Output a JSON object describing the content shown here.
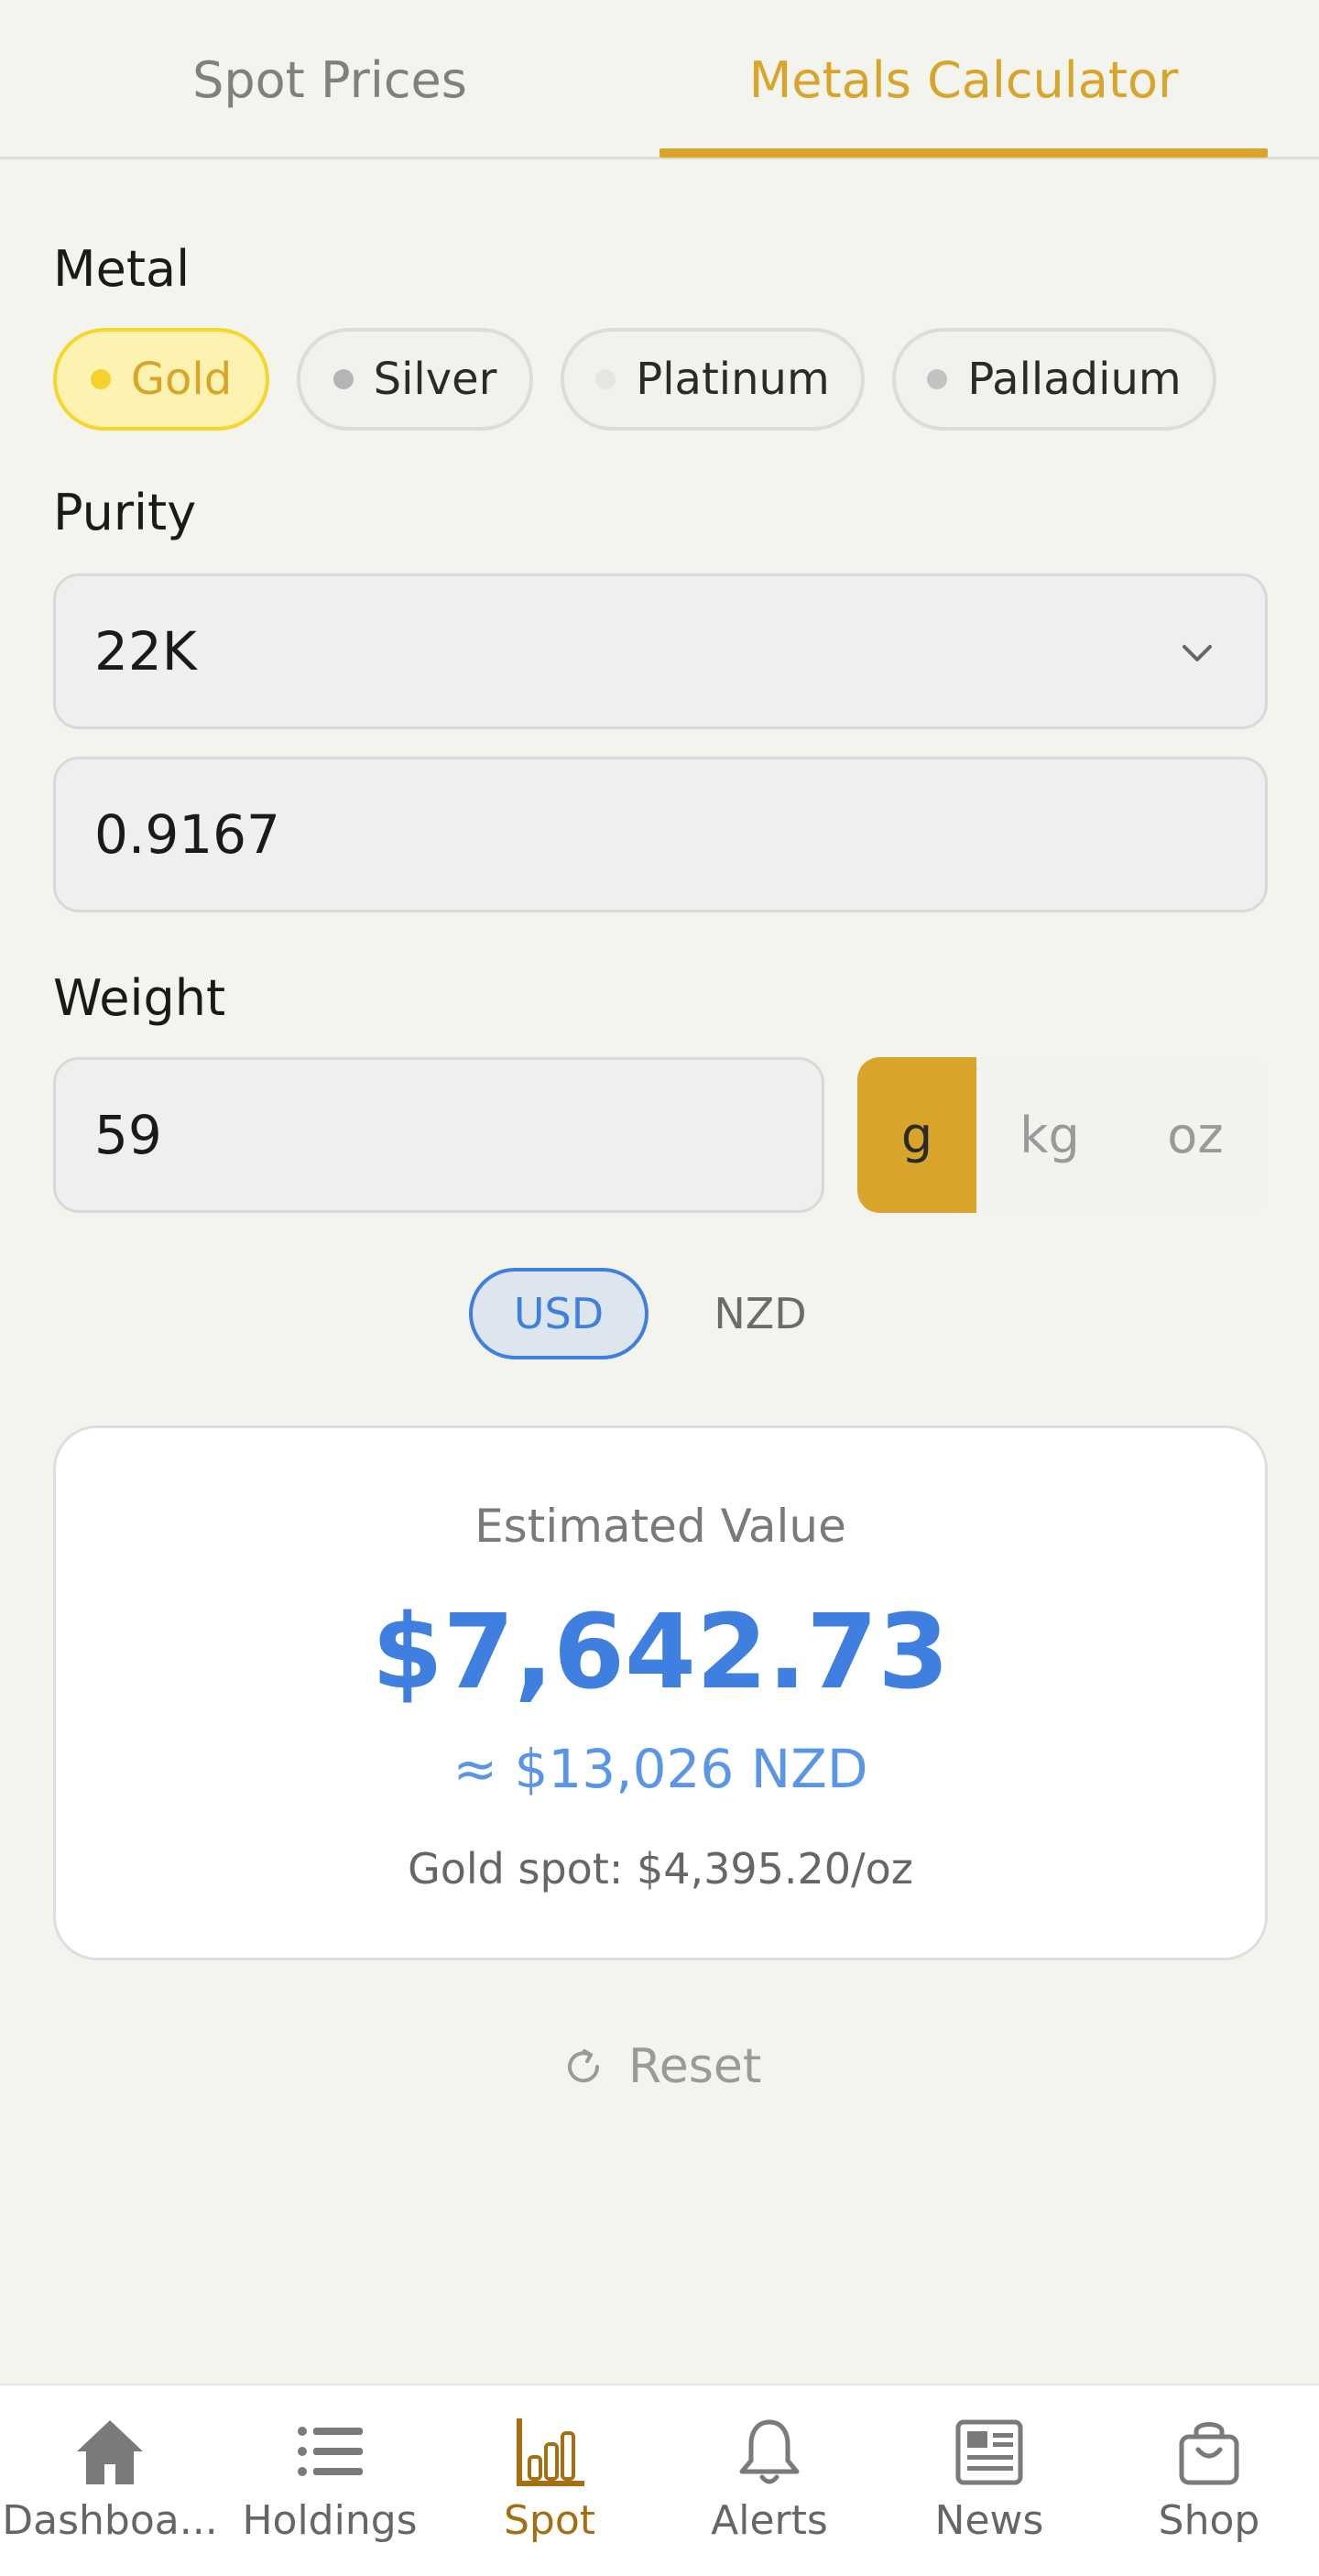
{
  "tabs": {
    "spot_prices": "Spot Prices",
    "metals_calculator": "Metals Calculator",
    "active": "metals_calculator"
  },
  "metal": {
    "label": "Metal",
    "options": [
      "Gold",
      "Silver",
      "Platinum",
      "Palladium"
    ],
    "selected": "Gold"
  },
  "purity": {
    "label": "Purity",
    "selected": "22K",
    "value": "0.9167"
  },
  "weight": {
    "label": "Weight",
    "value": "59",
    "units": [
      "g",
      "kg",
      "oz"
    ],
    "selected_unit": "g"
  },
  "currency": {
    "options": [
      "USD",
      "NZD"
    ],
    "selected": "USD"
  },
  "result": {
    "title": "Estimated Value",
    "value": "$7,642.73",
    "converted": "≈ $13,026 NZD",
    "spot": "Gold spot: $4,395.20/oz"
  },
  "reset_label": "Reset",
  "bottom_nav": {
    "items": [
      "Dashboa...",
      "Holdings",
      "Spot",
      "Alerts",
      "News",
      "Shop"
    ],
    "active": "Spot"
  },
  "colors": {
    "accent_gold": "#d8a42a",
    "accent_blue": "#3f7fe0",
    "background": "#f4f4ef",
    "active_nav": "#a66e12"
  }
}
